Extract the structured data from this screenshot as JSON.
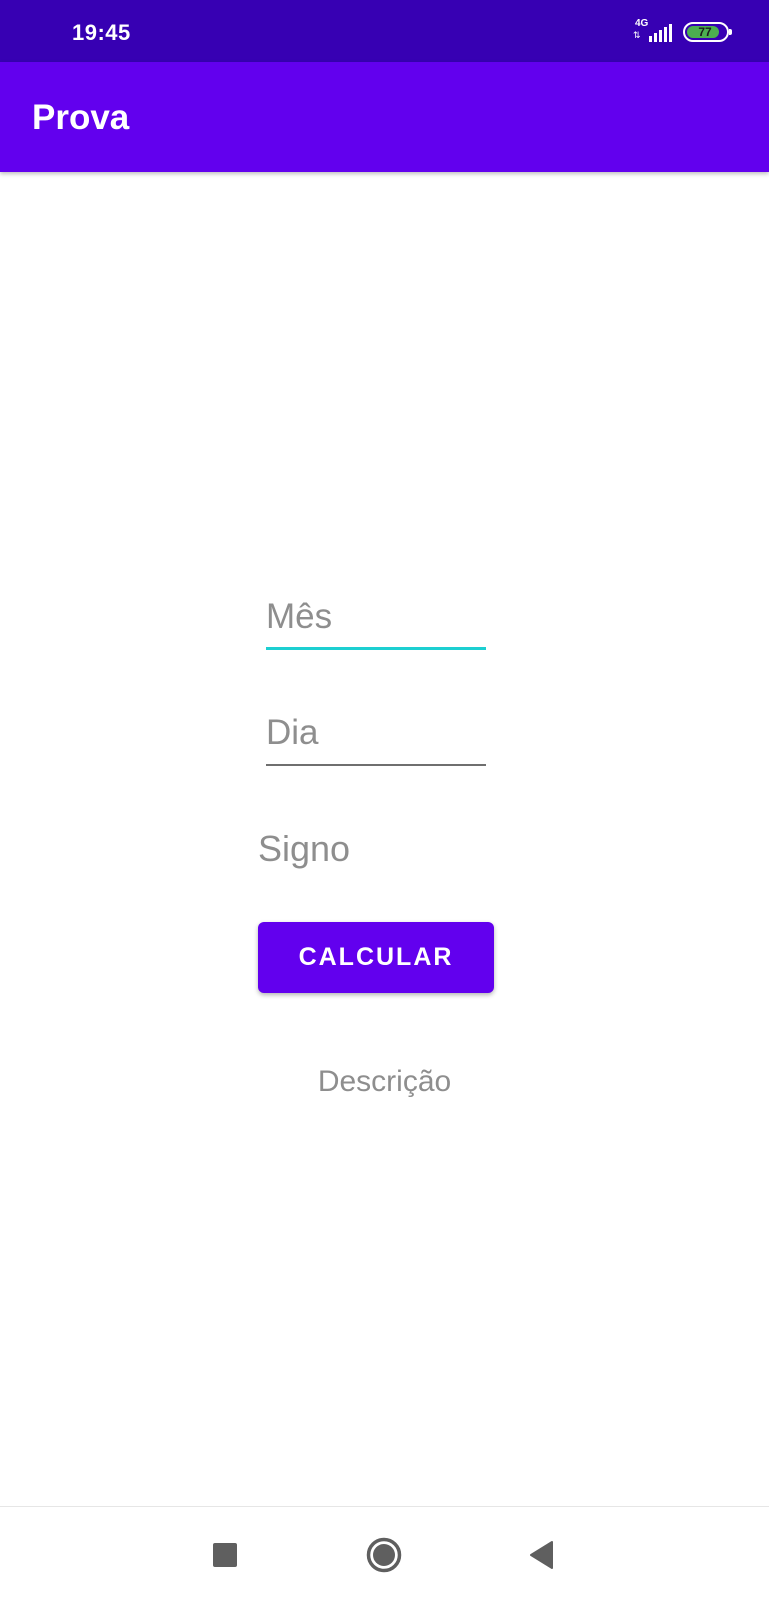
{
  "status_bar": {
    "time": "19:45",
    "network_type": "4G",
    "battery_level": "77"
  },
  "app_bar": {
    "title": "Prova"
  },
  "form": {
    "month_placeholder": "Mês",
    "day_placeholder": "Dia",
    "sign_label": "Signo",
    "calculate_button": "CALCULAR",
    "description_label": "Descrição"
  },
  "nav_bar": {
    "recent_icon": "square-icon",
    "home_icon": "circle-icon",
    "back_icon": "triangle-back-icon"
  },
  "colors": {
    "status_bar": "#3700b3",
    "app_bar": "#6200ee",
    "button": "#6200ee",
    "focused_underline": "#1ccfd1",
    "hint_text": "#8e8e8e"
  }
}
